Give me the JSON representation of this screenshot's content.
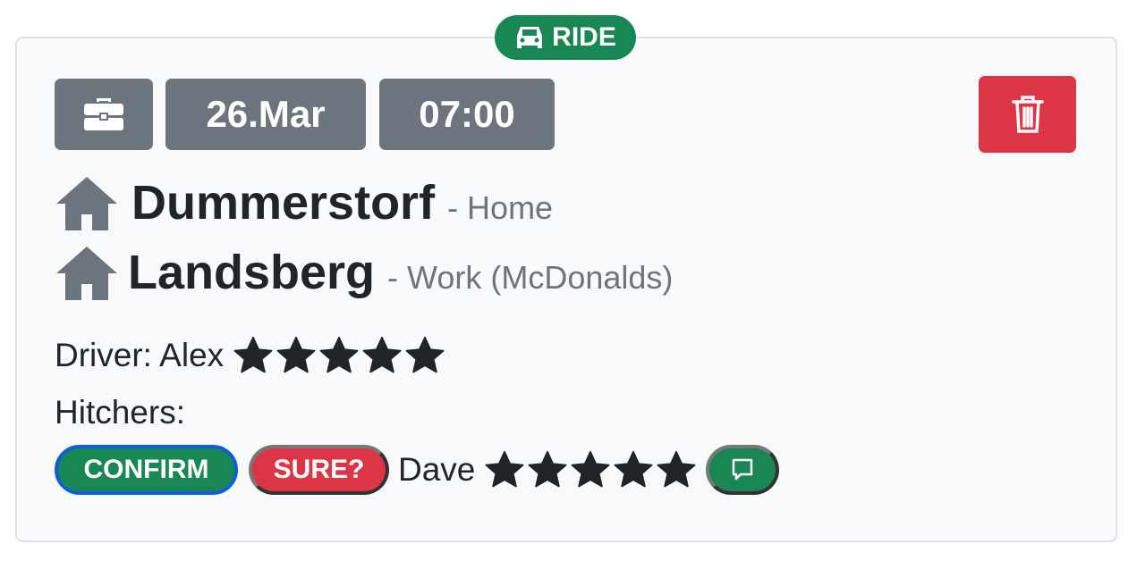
{
  "badge": {
    "label": "RIDE",
    "icon": "car-icon"
  },
  "header": {
    "category_icon": "briefcase-icon",
    "date": "26.Mar",
    "time": "07:00",
    "delete_icon": "trash-icon"
  },
  "route": [
    {
      "icon": "house-icon",
      "city": "Dummerstorf",
      "desc": "- Home"
    },
    {
      "icon": "house-icon",
      "city": "Landsberg",
      "desc": "- Work (McDonalds)"
    }
  ],
  "driver": {
    "label": "Driver: Alex",
    "rating": 5
  },
  "hitchers": {
    "label": "Hitchers:",
    "items": [
      {
        "confirm": "CONFIRM",
        "sure": "SURE?",
        "name": "Dave",
        "rating": 5,
        "chat_icon": "chat-icon"
      }
    ]
  },
  "colors": {
    "green": "#198754",
    "red": "#dc3545",
    "gray": "#6c757d"
  }
}
